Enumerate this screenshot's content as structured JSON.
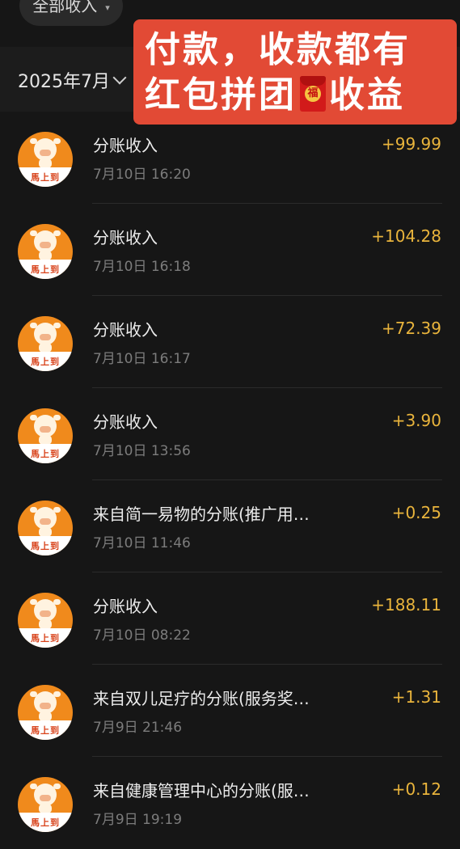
{
  "filter": {
    "label": "全部收入"
  },
  "month": {
    "label": "2025年7月"
  },
  "promo": {
    "line1": "付款，收款都有",
    "line2_left": "红包拼团",
    "envelope_char": "福",
    "line2_right": "收益"
  },
  "avatar_brand": "馬上到",
  "items": [
    {
      "title": "分账收入",
      "time": "7月10日 16:20",
      "amount": "+99.99"
    },
    {
      "title": "分账收入",
      "time": "7月10日 16:18",
      "amount": "+104.28"
    },
    {
      "title": "分账收入",
      "time": "7月10日 16:17",
      "amount": "+72.39"
    },
    {
      "title": "分账收入",
      "time": "7月10日 13:56",
      "amount": "+3.90"
    },
    {
      "title": "来自简一易物的分账(推广用…",
      "time": "7月10日 11:46",
      "amount": "+0.25"
    },
    {
      "title": "分账收入",
      "time": "7月10日 08:22",
      "amount": "+188.11"
    },
    {
      "title": "来自双儿足疗的分账(服务奖…",
      "time": "7月9日 21:46",
      "amount": "+1.31"
    },
    {
      "title": "来自健康管理中心的分账(服…",
      "time": "7月9日 19:19",
      "amount": "+0.12"
    }
  ],
  "colors": {
    "background": "#161616",
    "amount": "#e9b43c",
    "promo": "#e24a35",
    "avatar": "#f08a1c"
  }
}
